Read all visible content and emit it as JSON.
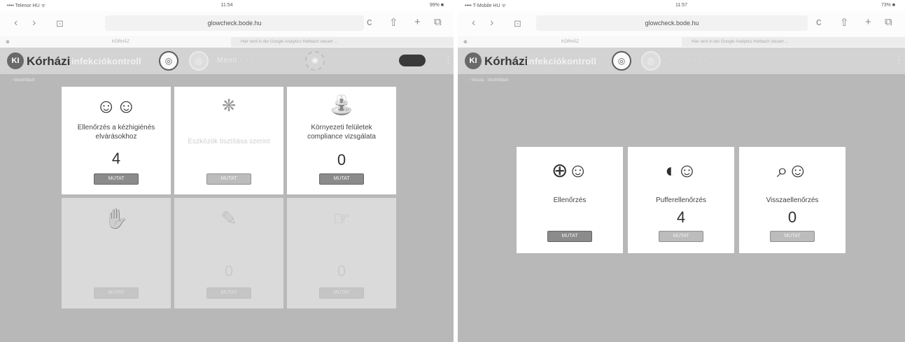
{
  "left": {
    "status": {
      "carrier": "•••• Telenor HU ᯤ",
      "time": "11:54",
      "battery": "99% ■"
    },
    "browser": {
      "url": "glowcheck.bode.hu",
      "tab1": "KÓRHÁZ",
      "tab2": "Hier wird in der Google Analytics Hellbach steuert ...",
      "back": "‹",
      "forward": "›",
      "bookmarks": "⊡",
      "reload": "c",
      "share": "⇧",
      "add": "+",
      "tabs": "⧉"
    },
    "app": {
      "brand": "Kórházi",
      "brand_sub": "infekciókontroll",
      "logo": "KI",
      "faded_nav": "Menü · · · ·",
      "crumb": "‹ Vezérlőpult"
    },
    "cards": [
      {
        "icon": "☺☺",
        "title": "Ellenőrzés a kézhigiénés elvárásokhoz",
        "count": "4",
        "button": "MUTAT"
      },
      {
        "icon": "❋",
        "title": "Eszközök tisztítása szerint",
        "count": "",
        "button": "MUTAT"
      },
      {
        "icon": "⛲",
        "title": "Környezeti felületek compliance vizsgálata",
        "count": "0",
        "button": "MUTAT"
      },
      {
        "icon": "✋",
        "title": "",
        "count": "",
        "button": "MUTAT"
      },
      {
        "icon": "✎",
        "title": "",
        "count": "0",
        "button": "MUTAT"
      },
      {
        "icon": "☞",
        "title": "",
        "count": "0",
        "button": "MUTAT"
      }
    ]
  },
  "right": {
    "status": {
      "carrier": "•••• T-Mobile HU ᯤ",
      "time": "11:57",
      "battery": "73% ■"
    },
    "browser": {
      "url": "glowcheck.bode.hu",
      "tab1": "KÓRHÁZ",
      "tab2": "Hier wird in der Google Analytics Hellbach steuert ...",
      "back": "‹",
      "forward": "›",
      "bookmarks": "⊡",
      "reload": "c",
      "share": "⇧",
      "add": "+",
      "tabs": "⧉"
    },
    "app": {
      "brand": "Kórházi",
      "brand_sub": "infekciókontroll",
      "logo": "KI",
      "faded_nav": "· · · · · · ·",
      "crumb": "‹ Vissza · Vezérlőpult"
    },
    "cards": [
      {
        "icon": "⊕☺",
        "title": "Ellenőrzés",
        "count": "",
        "button": "MUTAT"
      },
      {
        "icon": "◐☺",
        "title": "Pufferellenőrzés",
        "count": "4",
        "button": "MUTAT"
      },
      {
        "icon": "⌕☺",
        "title": "Visszaellenőrzés",
        "count": "0",
        "button": "MUTAT"
      }
    ]
  }
}
